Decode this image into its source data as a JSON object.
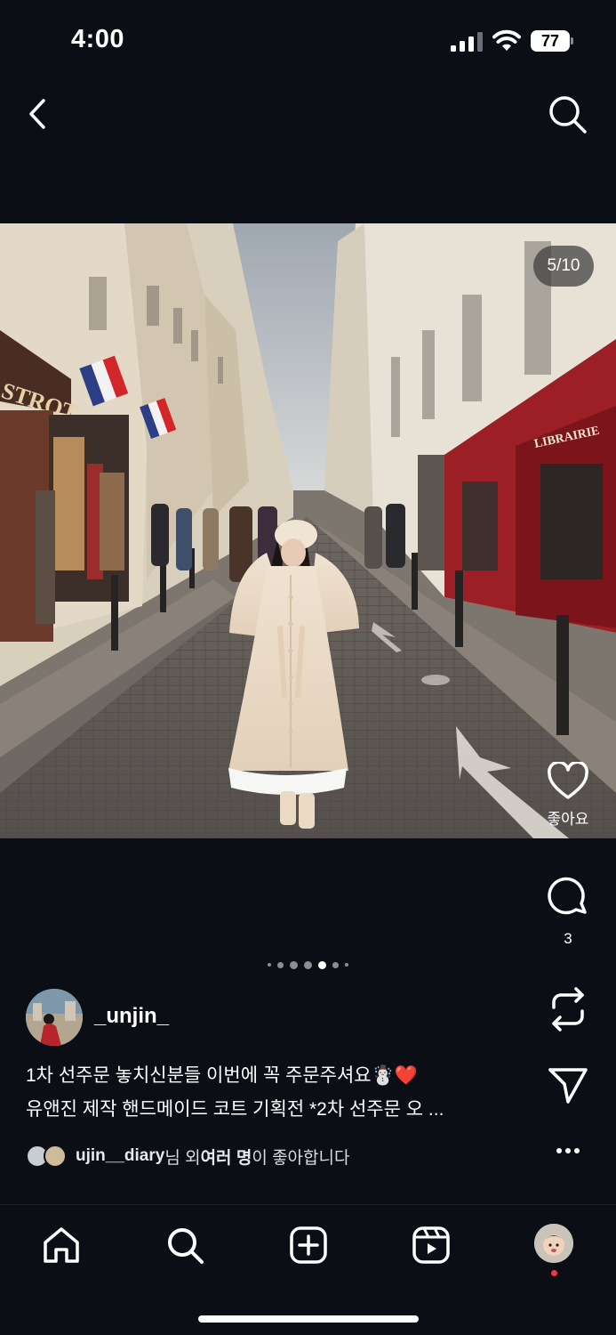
{
  "status_bar": {
    "time": "4:00",
    "battery": "77",
    "icons": [
      "signal-icon",
      "wifi-icon",
      "battery-icon"
    ]
  },
  "nav": {
    "back_icon": "chevron-left-icon",
    "search_icon": "search-icon"
  },
  "post": {
    "page_indicator": "5/10",
    "image_index": 5,
    "image_count": 10,
    "storefront_signs": [
      "STROT",
      "LIBRAIRIE"
    ]
  },
  "actions": {
    "like_label": "좋아요",
    "comment_count": "3",
    "icons": [
      "heart-icon",
      "comment-icon",
      "repost-icon",
      "send-icon",
      "more-icon"
    ]
  },
  "author": {
    "username": "_unjin_"
  },
  "caption": {
    "line1": "1차 선주문 놓치신분들 이번에 꼭 주문주셔요☃️❤️",
    "line2": "유앤진 제작 핸드메이드 코트 기획전 *2차 선주문 오 ..."
  },
  "likes": {
    "user": "ujin__diary",
    "mid": "님 외 ",
    "bold": "여러 명",
    "end": "이 좋아합니다"
  },
  "tabbar": {
    "items": [
      "home-icon",
      "search-icon",
      "add-icon",
      "reels-icon",
      "profile-avatar"
    ]
  },
  "colors": {
    "background": "#0b0f15",
    "text": "#ffffff",
    "notification_dot": "#ff3040"
  }
}
